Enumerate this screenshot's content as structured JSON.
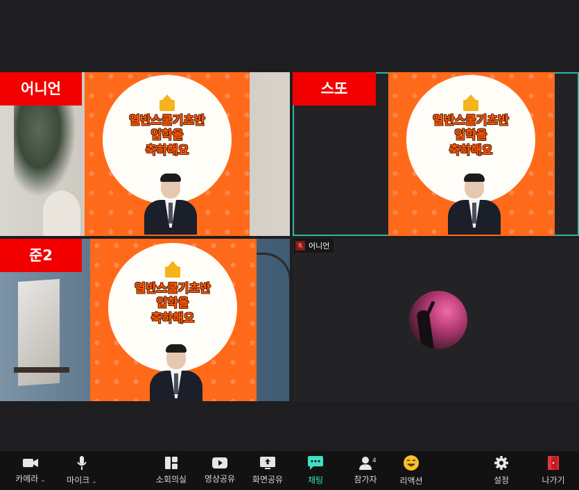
{
  "tiles": [
    {
      "name_tag": "어니언",
      "banner": [
        "열반스쿨기초반",
        "입학을",
        "축하해요"
      ]
    },
    {
      "name_tag": "스또",
      "banner": [
        "열반스쿨기초반",
        "입학을",
        "축하해요"
      ]
    },
    {
      "name_tag": "준2",
      "banner": [
        "열반스쿨기초반",
        "입학을",
        "축하해요"
      ]
    },
    {
      "participant_label": "어니언"
    }
  ],
  "toolbar": {
    "camera": "카메라",
    "mic": "마이크",
    "breakout": "소회의실",
    "video_share": "영상공유",
    "screen_share": "화면공유",
    "chat": "채팅",
    "participants": "참가자",
    "participants_count": "4",
    "reactions": "리액션",
    "settings": "설정",
    "leave": "나가기"
  },
  "colors": {
    "accent": "#2fb6a6",
    "name_tag": "#f20000",
    "card": "#ff6a1a",
    "chat_active": "#3fe0c4",
    "leave": "#e8333a"
  }
}
